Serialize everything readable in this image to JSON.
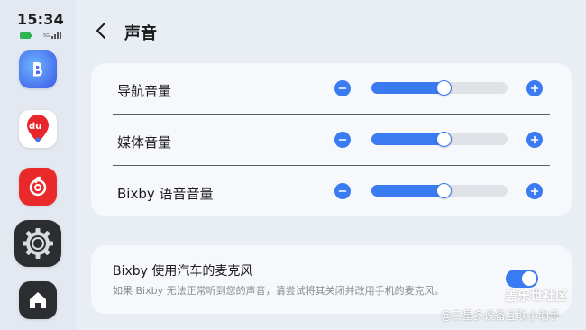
{
  "status_bar": {
    "time": "15:34",
    "battery_label": "",
    "network_label": "5G"
  },
  "dock": {
    "apps": [
      {
        "name": "Bixby"
      },
      {
        "name": "du"
      },
      {
        "name": "NetEase Music"
      },
      {
        "name": "Settings"
      },
      {
        "name": "Home"
      }
    ],
    "du_text": "du"
  },
  "header": {
    "title": "声音"
  },
  "volume": {
    "rows": [
      {
        "label": "导航音量",
        "level": 0.53
      },
      {
        "label": "媒体音量",
        "level": 0.53
      },
      {
        "label": "Bixby 语音音量",
        "level": 0.53
      }
    ]
  },
  "mic": {
    "title": "Bixby 使用汽车的麦克风",
    "description": "如果 Bixby 无法正常听到您的声音，请尝试将其关闭并改用手机的麦克风。",
    "enabled": true
  },
  "watermark": {
    "title": "盖乐世社区",
    "subtitle": "@三星多设备互联小助手"
  },
  "colors": {
    "accent": "#3a7bf2",
    "card": "#f6f8fb",
    "background": "#e9eef5"
  }
}
